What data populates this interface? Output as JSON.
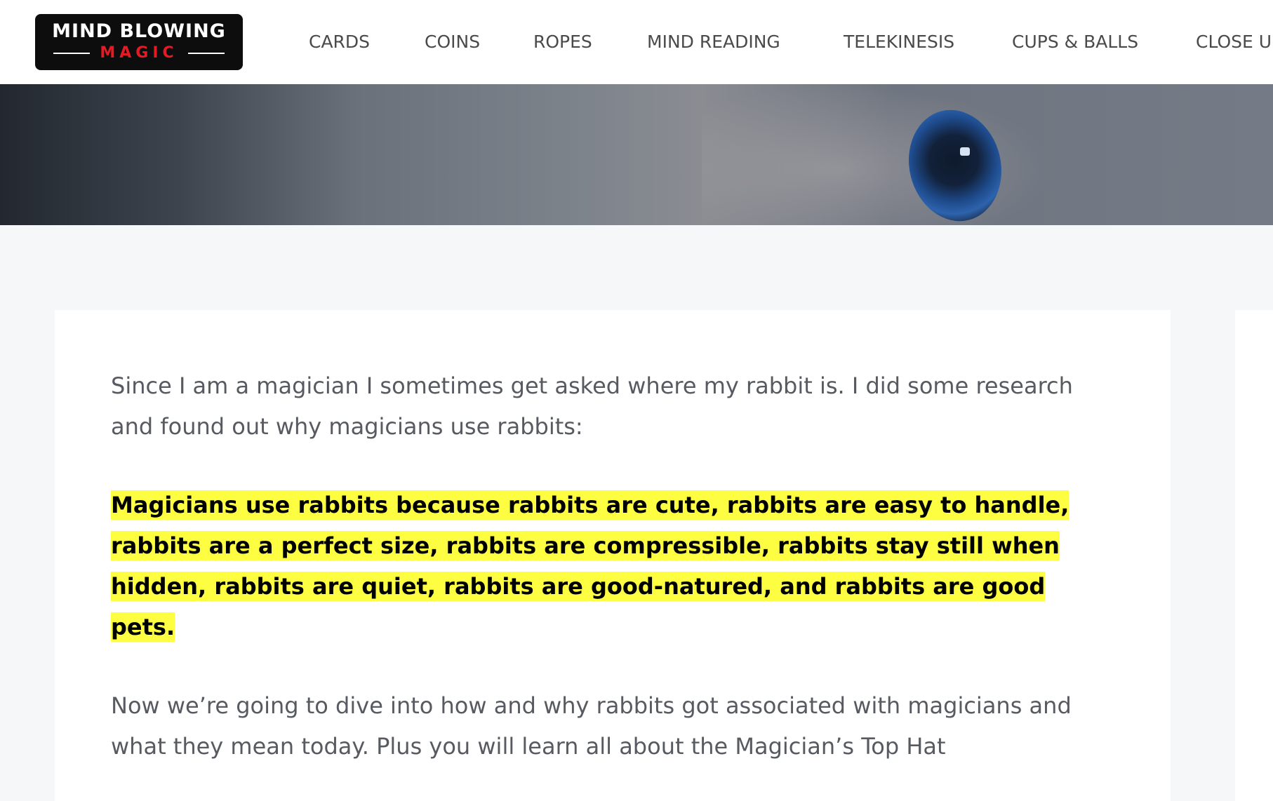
{
  "header": {
    "logo": {
      "top": "MIND BLOWING",
      "bottom": "MAGIC"
    },
    "nav": [
      {
        "label": "CARDS"
      },
      {
        "label": "COINS"
      },
      {
        "label": "ROPES"
      },
      {
        "label": "MIND READING"
      },
      {
        "label": "TELEKINESIS"
      },
      {
        "label": "CUPS & BALLS"
      },
      {
        "label": "CLOSE U"
      }
    ]
  },
  "hero": {
    "image": "rabbit-eye-closeup"
  },
  "article": {
    "intro": "Since I am a magician I sometimes get asked where my rabbit is. I did some research and found out why magicians use rabbits:",
    "highlight": "Magicians use rabbits because rabbits are cute, rabbits are easy to handle, rabbits are a perfect size, rabbits are compressible, rabbits stay still when hidden, rabbits are quiet, rabbits are good-natured, and rabbits are good pets.",
    "followup": "Now we’re going to dive into how and why rabbits got associated with magicians and what they mean today. Plus you will learn all about the Magician’s Top Hat"
  },
  "colors": {
    "highlight": "#fdfd42",
    "logo_accent": "#e31b23",
    "text_muted": "#575a60",
    "page_bg": "#f6f7f9"
  }
}
